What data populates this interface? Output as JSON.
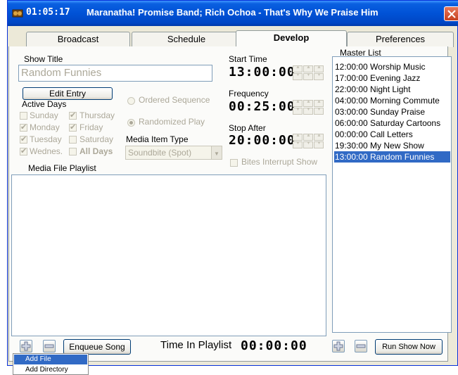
{
  "window": {
    "time": "01:05:17",
    "title": "Maranatha! Promise Band; Rich Ochoa - That's Why We Praise Him",
    "icons": {
      "app": "app-icon",
      "close": "close-icon"
    }
  },
  "tabs": [
    {
      "label": "Broadcast",
      "active": false
    },
    {
      "label": "Schedule",
      "active": false
    },
    {
      "label": "Develop",
      "active": true
    },
    {
      "label": "Preferences",
      "active": false
    }
  ],
  "develop": {
    "show_title_label": "Show Title",
    "show_title_value": "Random Funnies",
    "edit_entry_label": "Edit Entry",
    "active_days_label": "Active Days",
    "days": [
      {
        "label": "Sunday",
        "checked": false
      },
      {
        "label": "Thursday",
        "checked": true
      },
      {
        "label": "Monday",
        "checked": true
      },
      {
        "label": "Friday",
        "checked": true
      },
      {
        "label": "Tuesday",
        "checked": true
      },
      {
        "label": "Saturday",
        "checked": false
      },
      {
        "label": "Wednes.",
        "checked": true
      },
      {
        "label": "All Days",
        "checked": false
      }
    ],
    "ordered_sequence_label": "Ordered Sequence",
    "randomized_play_label": "Randomized Play",
    "media_item_type_label": "Media Item Type",
    "media_item_type_value": "Soundbite (Spot)",
    "start_time_label": "Start Time",
    "start_time_value": "13:00:00",
    "frequency_label": "Frequency",
    "frequency_value": "00:25:00",
    "stop_after_label": "Stop After",
    "stop_after_value": "20:00:00",
    "bites_interrupt_label": "Bites Interrupt Show",
    "media_file_playlist_label": "Media File Playlist",
    "enqueue_song_label": "Enqueue Song",
    "time_in_playlist_label": "Time In Playlist",
    "time_in_playlist_value": "00:00:00",
    "run_show_now_label": "Run Show Now"
  },
  "master_list": {
    "label": "Master List",
    "items": [
      {
        "label": "12:00:00 Worship Music",
        "selected": false
      },
      {
        "label": "17:00:00 Evening Jazz",
        "selected": false
      },
      {
        "label": "22:00:00 Night Light",
        "selected": false
      },
      {
        "label": "04:00:00 Morning Commute",
        "selected": false
      },
      {
        "label": "03:00:00 Sunday Praise",
        "selected": false
      },
      {
        "label": "06:00:00 Saturday Cartoons",
        "selected": false
      },
      {
        "label": "00:00:00 Call Letters",
        "selected": false
      },
      {
        "label": "19:30:00 My New Show",
        "selected": false
      },
      {
        "label": "13:00:00 Random Funnies",
        "selected": true
      }
    ]
  },
  "context_menu": {
    "items": [
      {
        "label": "Add File",
        "highlighted": true
      },
      {
        "label": "Add Directory",
        "highlighted": false
      }
    ]
  },
  "colors": {
    "titlebar": "#0052d6",
    "selection": "#316ac5",
    "disabled_text": "#aca899"
  }
}
